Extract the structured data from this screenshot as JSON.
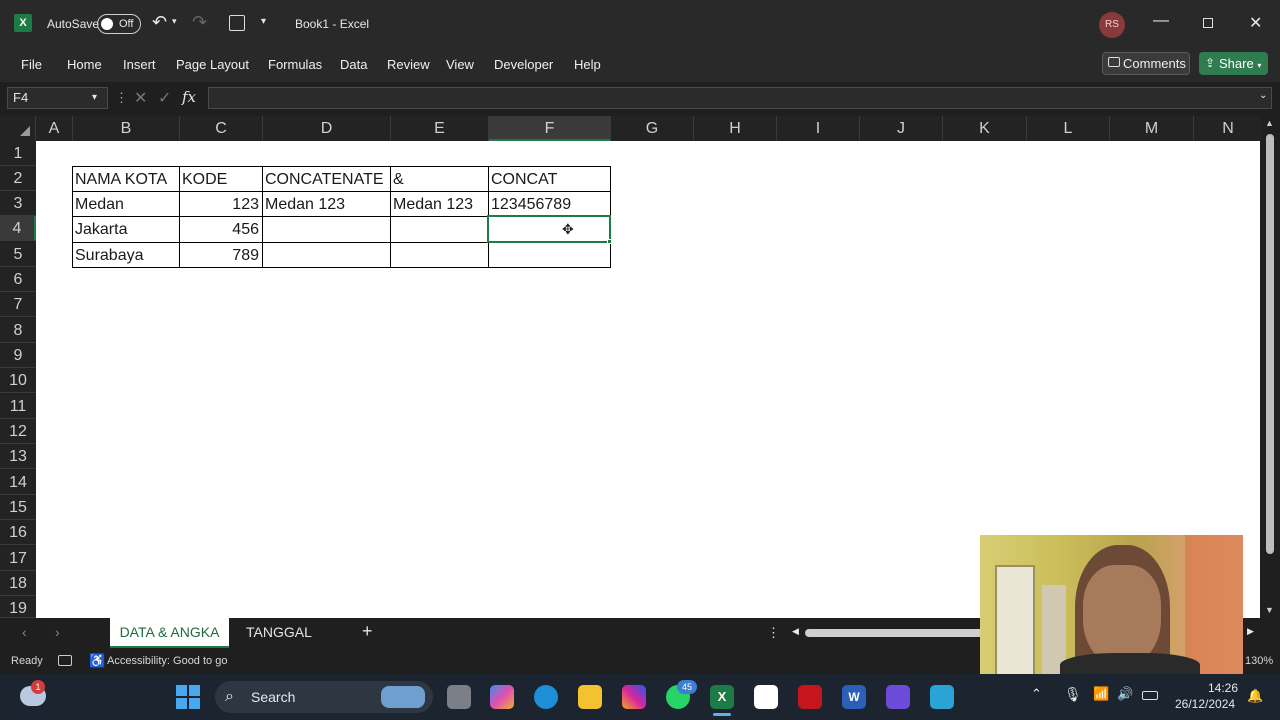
{
  "titlebar": {
    "autosave_label": "AutoSave",
    "autosave_state": "Off",
    "document_title": "Book1  -  Excel",
    "user_initials": "RS"
  },
  "ribbon": {
    "tabs": [
      "File",
      "Home",
      "Insert",
      "Page Layout",
      "Formulas",
      "Data",
      "Review",
      "View",
      "Developer",
      "Help"
    ],
    "comments_label": "Comments",
    "share_label": "Share"
  },
  "formula_bar": {
    "name_box": "F4",
    "fx_label": "fx",
    "formula": ""
  },
  "columns": [
    "A",
    "B",
    "C",
    "D",
    "E",
    "F",
    "G",
    "H",
    "I",
    "J",
    "K",
    "L",
    "M",
    "N"
  ],
  "rows": [
    "1",
    "2",
    "3",
    "4",
    "5",
    "6",
    "7",
    "8",
    "9",
    "10",
    "11",
    "12",
    "13",
    "14",
    "15",
    "16",
    "17",
    "18",
    "19"
  ],
  "cells": {
    "B2": "NAMA KOTA",
    "C2": "KODE",
    "D2": "CONCATENATE",
    "E2": "&",
    "F2": "CONCAT",
    "B3": "Medan",
    "C3": "123",
    "D3": "Medan 123",
    "E3": "Medan 123",
    "F3": "123456789",
    "B4": "Jakarta",
    "C4": "456",
    "B5": "Surabaya",
    "C5": "789"
  },
  "sheet_tabs": {
    "active": "DATA & ANGKA",
    "other": "TANGGAL",
    "add_symbol": "+"
  },
  "status": {
    "ready": "Ready",
    "accessibility": "Accessibility: Good to go",
    "zoom": "130%"
  },
  "taskbar": {
    "search_label": "Search",
    "whatsapp_badge": "45",
    "weather_badge": "1",
    "time": "14:26",
    "date": "26/12/2024"
  },
  "colors": {
    "excel_green": "#1d7c45",
    "share_green": "#2f7d4f",
    "selection_border": "#1d7c45"
  }
}
